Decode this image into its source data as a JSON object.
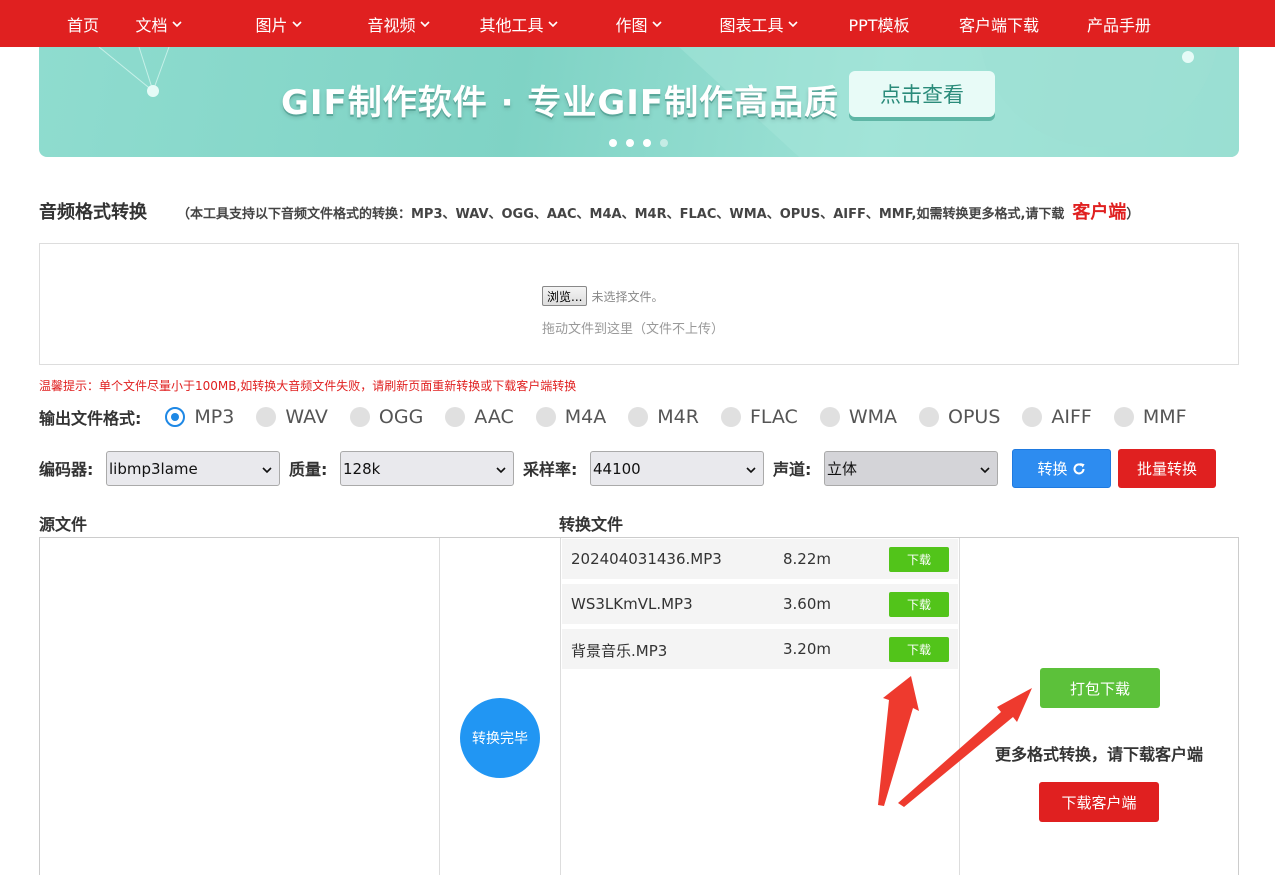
{
  "nav": {
    "items": [
      {
        "label": "首页",
        "dropdown": false
      },
      {
        "label": "文档",
        "dropdown": true
      },
      {
        "label": "图片",
        "dropdown": true
      },
      {
        "label": "音视频",
        "dropdown": true
      },
      {
        "label": "其他工具",
        "dropdown": true
      },
      {
        "label": "作图",
        "dropdown": true
      },
      {
        "label": "图表工具",
        "dropdown": true
      },
      {
        "label": "PPT模板",
        "dropdown": false
      },
      {
        "label": "客户端下载",
        "dropdown": false
      },
      {
        "label": "产品手册",
        "dropdown": false
      }
    ]
  },
  "banner": {
    "text": "GIF制作软件 · 专业GIF制作高品质",
    "button": "点击查看",
    "slide_count": 4,
    "active_slide": 0
  },
  "tool": {
    "title": "音频格式转换",
    "subtitle": "（本工具支持以下音频文件格式的转换：MP3、WAV、OGG、AAC、M4A、M4R、FLAC、WMA、OPUS、AIFF、MMF,如需转换更多格式,请下载",
    "client_link": "客户端",
    "subtitle_end": "）"
  },
  "upload": {
    "browse_label": "浏览...",
    "no_file": "未选择文件。",
    "drop_hint": "拖动文件到这里（文件不上传）"
  },
  "warning": "温馨提示：单个文件尽量小于100MB,如转换大音频文件失败，请刷新页面重新转换或下载客户端转换",
  "format": {
    "label": "输出文件格式:",
    "options": [
      "MP3",
      "WAV",
      "OGG",
      "AAC",
      "M4A",
      "M4R",
      "FLAC",
      "WMA",
      "OPUS",
      "AIFF",
      "MMF"
    ],
    "selected": "MP3"
  },
  "settings": {
    "encoder_label": "编码器:",
    "encoder_value": "libmp3lame",
    "quality_label": "质量:",
    "quality_value": "128k",
    "samplerate_label": "采样率:",
    "samplerate_value": "44100",
    "channel_label": "声道:",
    "channel_value": "立体",
    "convert_button": "转换",
    "batch_button": "批量转换"
  },
  "sections": {
    "source_label": "源文件",
    "output_label": "转换文件",
    "done_label": "转换完毕"
  },
  "output_files": [
    {
      "name": "202404031436.MP3",
      "size": "8.22m",
      "action": "下载"
    },
    {
      "name": "WS3LKmVL.MP3",
      "size": "3.60m",
      "action": "下载"
    },
    {
      "name": "背景音乐.MP3",
      "size": "3.20m",
      "action": "下载"
    }
  ],
  "side": {
    "pack_download": "打包下载",
    "more_text": "更多格式转换，请下载客户端",
    "client_download": "下载客户端"
  },
  "colors": {
    "brand_red": "#e02020",
    "banner_teal": "#8fdccf",
    "primary_blue": "#2d8cf0",
    "success_green": "#52c41a"
  }
}
